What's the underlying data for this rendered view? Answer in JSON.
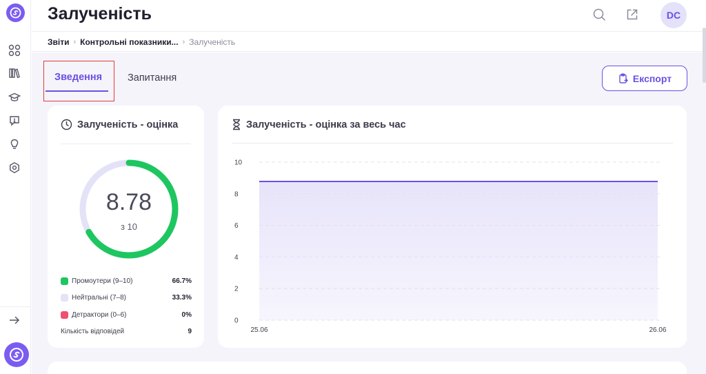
{
  "header": {
    "title": "Залученість",
    "avatar_initials": "DC"
  },
  "breadcrumb": {
    "items": [
      "Звіти",
      "Контрольні показники...",
      "Залученість"
    ]
  },
  "tabs": [
    {
      "label": "Зведення",
      "active": true
    },
    {
      "label": "Запитання",
      "active": false
    }
  ],
  "toolbar": {
    "export_label": "Експорт"
  },
  "score_card": {
    "title": "Залученість - оцінка",
    "score": "8.78",
    "score_out_of": "з 10",
    "gauge_fraction": 0.667,
    "legend": [
      {
        "label": "Промоутери (9–10)",
        "value": "66.7%",
        "color": "#1ec660"
      },
      {
        "label": "Нейтральні (7–8)",
        "value": "33.3%",
        "color": "#e4e2f7"
      },
      {
        "label": "Детрактори (0–6)",
        "value": "0%",
        "color": "#f0506e"
      }
    ],
    "responses_label": "Кількість відповідей",
    "responses_value": "9"
  },
  "chart_card": {
    "title": "Залученість - оцінка за весь час"
  },
  "chart_data": {
    "type": "area",
    "x": [
      "25.06",
      "26.06"
    ],
    "series": [
      {
        "values": [
          8.78,
          8.78
        ]
      }
    ],
    "ylim": [
      0,
      10
    ],
    "yticks": [
      0,
      2,
      4,
      6,
      8,
      10
    ],
    "grid": true,
    "line_color": "#6b4fe3",
    "fill_color": "#e7e4fa"
  },
  "colors": {
    "accent": "#6b4fe3",
    "promoters": "#1ec660",
    "neutral": "#e4e2f7",
    "detractors": "#f0506e"
  },
  "icons": {
    "sidebar": [
      "apps-icon",
      "library-icon",
      "education-icon",
      "feedback-icon",
      "idea-icon",
      "settings-icon"
    ],
    "header": [
      "search-icon",
      "open-external-icon"
    ]
  }
}
